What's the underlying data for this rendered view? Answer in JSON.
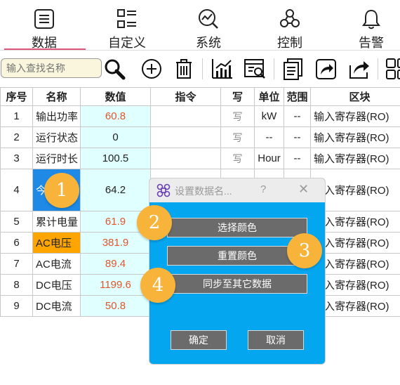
{
  "tabs": [
    {
      "label": "数据",
      "icon": "list-icon"
    },
    {
      "label": "自定义",
      "icon": "grid-list-icon"
    },
    {
      "label": "系统",
      "icon": "chart-search-icon"
    },
    {
      "label": "控制",
      "icon": "nodes-icon"
    },
    {
      "label": "告警",
      "icon": "bell-icon"
    }
  ],
  "toolbar": {
    "search_placeholder": "输入查找名称",
    "tools": [
      "search-icon",
      "add-icon",
      "delete-icon",
      "line-chart-icon",
      "table-search-icon",
      "document-icon",
      "share-icon",
      "export-icon",
      "apps-icon"
    ]
  },
  "table": {
    "headers": [
      "序号",
      "名称",
      "数值",
      "指令",
      "写",
      "单位",
      "范围",
      "区块"
    ],
    "rows": [
      {
        "idx": "1",
        "name": "输出功率",
        "value": "60.8",
        "cmd": "",
        "write": "写",
        "unit": "kW",
        "range": "--",
        "block": "输入寄存器(RO)"
      },
      {
        "idx": "2",
        "name": "运行状态",
        "value": "0",
        "cmd": "",
        "write": "写",
        "unit": "--",
        "range": "--",
        "block": "输入寄存器(RO)"
      },
      {
        "idx": "3",
        "name": "运行时长",
        "value": "100.5",
        "cmd": "",
        "write": "写",
        "unit": "Hour",
        "range": "--",
        "block": "输入寄存器(RO)"
      },
      {
        "idx": "4",
        "name": "今",
        "value": "64.2",
        "cmd": "",
        "write": "",
        "unit": "",
        "range": "",
        "block": "输入寄存器(RO)"
      },
      {
        "idx": "5",
        "name": "累计电量",
        "value": "61.9",
        "cmd": "",
        "write": "",
        "unit": "",
        "range": "",
        "block": "输入寄存器(RO)"
      },
      {
        "idx": "6",
        "name": "AC电压",
        "value": "381.9",
        "cmd": "",
        "write": "",
        "unit": "",
        "range": "",
        "block": "输入寄存器(RO)"
      },
      {
        "idx": "7",
        "name": "AC电流",
        "value": "89.4",
        "cmd": "",
        "write": "",
        "unit": "",
        "range": "",
        "block": "输入寄存器(RO)"
      },
      {
        "idx": "8",
        "name": "DC电压",
        "value": "1199.6",
        "cmd": "",
        "write": "",
        "unit": "",
        "range": "",
        "block": "输入寄存器(RO)"
      },
      {
        "idx": "9",
        "name": "DC电流",
        "value": "50.8",
        "cmd": "",
        "write": "",
        "unit": "",
        "range": "",
        "block": "输入寄存器(RO)"
      }
    ]
  },
  "dialog": {
    "title": "设置数据名...",
    "help": "?",
    "close": "✕",
    "select_color": "选择颜色",
    "reset_color": "重置颜色",
    "sync": "同步至其它数据",
    "ok": "确定",
    "cancel": "取消"
  },
  "badges": [
    "1",
    "2",
    "3",
    "4"
  ],
  "colors": {
    "accent_underline": "#e0567a",
    "value_red": "#e3552c",
    "value_bg": "#e0ffff",
    "selected_cell": "#1e8ae6",
    "highlight_cell": "#ffa500",
    "dialog_bg": "#05a6f0",
    "dialog_button": "#6b6b6b",
    "badge": "#f7b33a"
  }
}
